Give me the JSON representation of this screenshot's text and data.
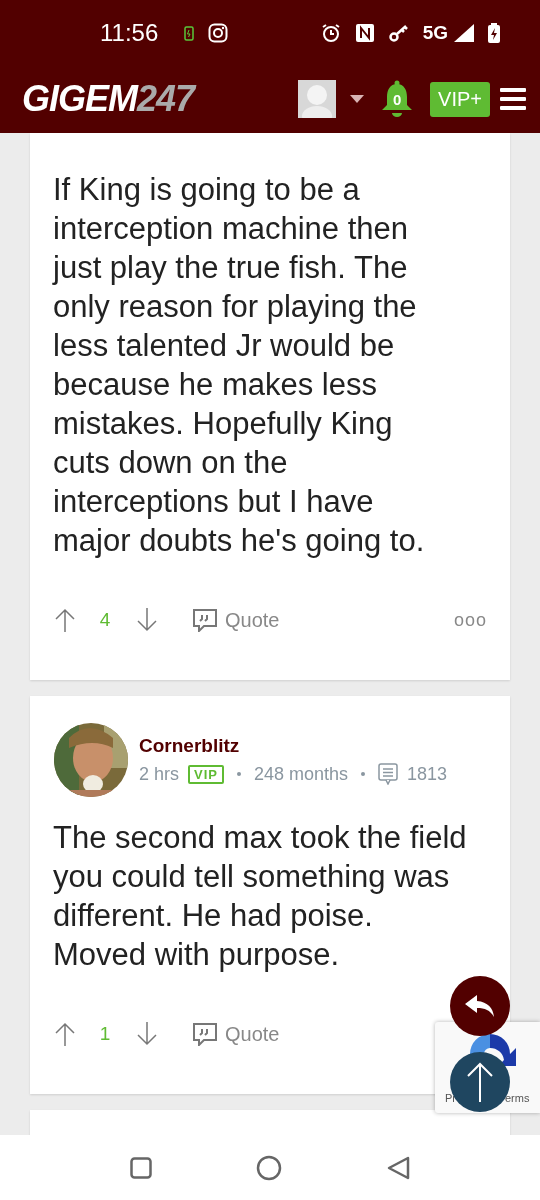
{
  "status_bar": {
    "time": "11:56",
    "network": "5G"
  },
  "header": {
    "logo_main": "GIGEM",
    "logo_suffix": "247",
    "notifications": "0",
    "vip_button": "VIP+"
  },
  "posts": [
    {
      "body": "If King is going to be a interception machine then just play the true fish. The only reason for playing the less talented Jr would be because he makes less mistakes. Hopefully King cuts down on the interceptions but I have major doubts he's going to.",
      "votes": "4",
      "quote": "Quote",
      "more": "ooo"
    },
    {
      "author": "Cornerblitz",
      "time": "2 hrs",
      "badge": "VIP",
      "tenure": "248 months",
      "post_count": "1813",
      "body": "The second max took the field you could tell something was different. He had poise. Moved with purpose.",
      "votes": "1",
      "quote": "Quote"
    }
  ],
  "recaptcha": {
    "left_text": "Pr",
    "right_text": "erms"
  }
}
